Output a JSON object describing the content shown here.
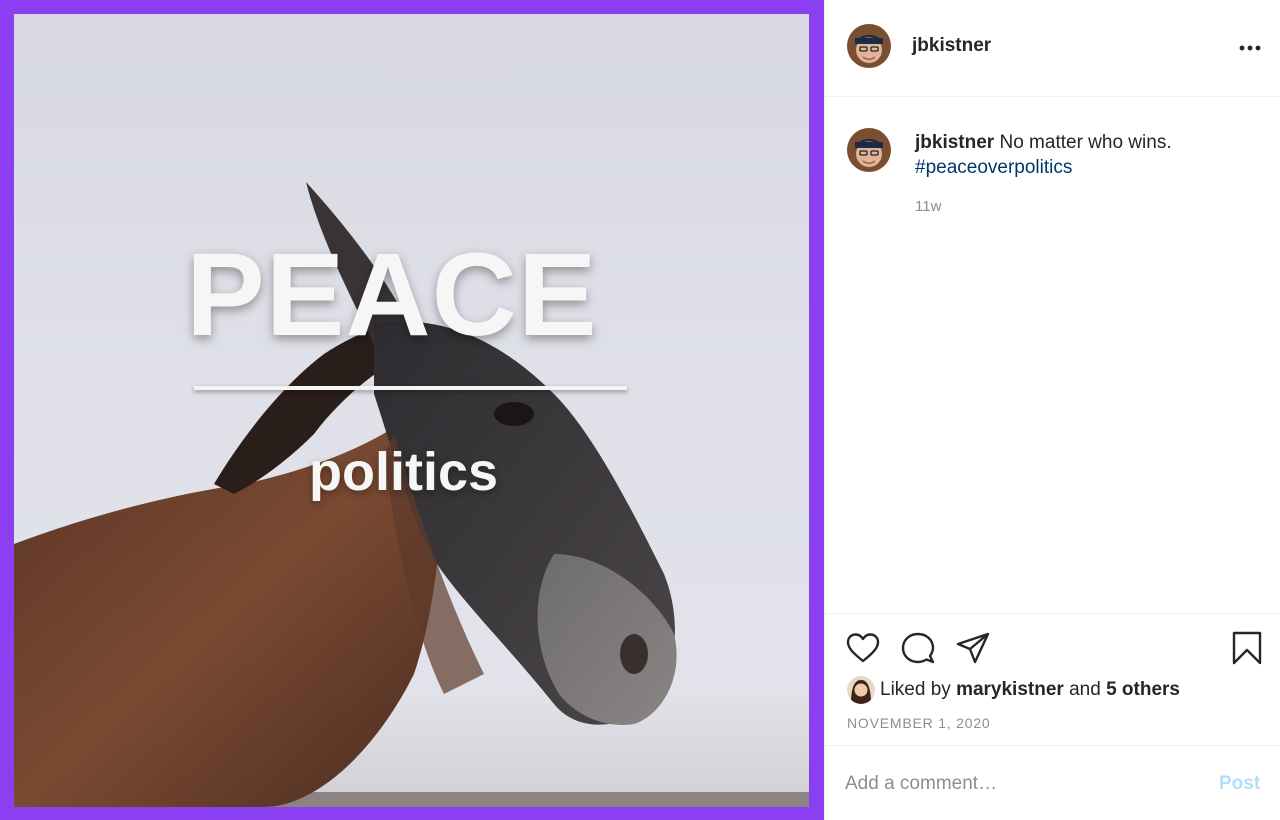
{
  "post": {
    "image": {
      "overlay_title": "PEACE",
      "overlay_subtitle": "politics",
      "frame_color": "#8a3ff0"
    },
    "author": {
      "username": "jbkistner",
      "avatar_icon": "profile-photo"
    },
    "header": {
      "more_icon": "more-horizontal-icon"
    },
    "caption": {
      "username": "jbkistner",
      "text": "No matter who wins.",
      "hashtag": "#peaceoverpolitics",
      "age": "11w"
    },
    "actions": {
      "icons": [
        "heart-icon",
        "comment-icon",
        "share-icon",
        "bookmark-icon"
      ]
    },
    "likes": {
      "prefix": "Liked by",
      "first_user": "marykistner",
      "connector": "and",
      "others": "5 others"
    },
    "date": "NOVEMBER 1, 2020",
    "comment": {
      "placeholder": "Add a comment…",
      "post_label": "Post"
    }
  },
  "colors": {
    "accent_link": "#00376b",
    "post_button_disabled": "#b2dffc",
    "secondary_text": "#8e8e8e"
  }
}
